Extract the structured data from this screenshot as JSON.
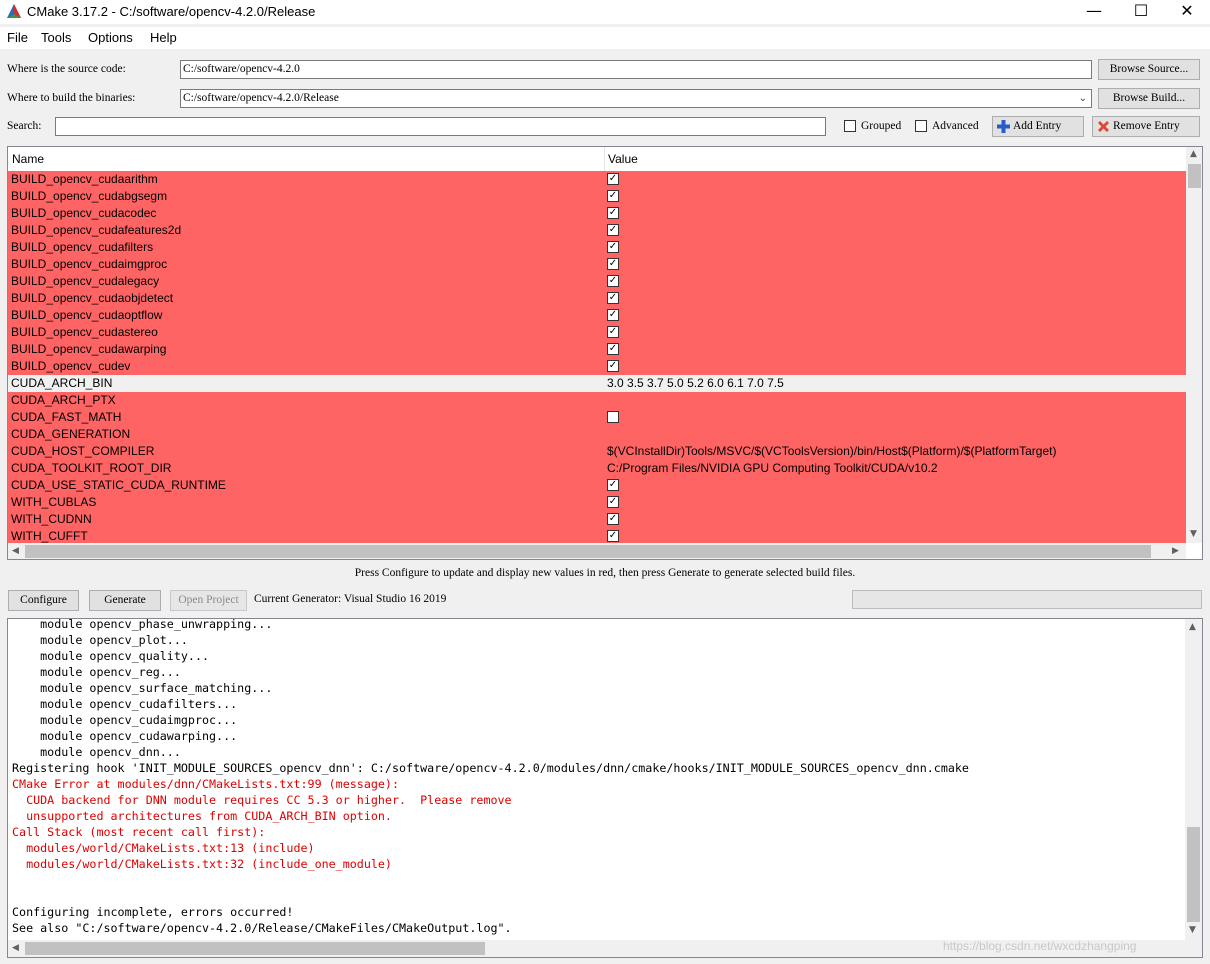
{
  "window": {
    "title": "CMake 3.17.2 - C:/software/opencv-4.2.0/Release",
    "min": "—",
    "max": "☐",
    "close": "✕"
  },
  "menu": [
    "File",
    "Tools",
    "Options",
    "Help"
  ],
  "source": {
    "label": "Where is the source code:",
    "value": "C:/software/opencv-4.2.0",
    "browse": "Browse Source..."
  },
  "build": {
    "label": "Where to build the binaries:",
    "value": "C:/software/opencv-4.2.0/Release",
    "browse": "Browse Build..."
  },
  "search": {
    "label": "Search:",
    "value": ""
  },
  "options": {
    "grouped": "Grouped",
    "advanced": "Advanced",
    "add": "Add Entry",
    "remove": "Remove Entry"
  },
  "table": {
    "columns": [
      "Name",
      "Value"
    ],
    "rows": [
      {
        "name": "BUILD_opencv_cudaarithm",
        "check": true,
        "red": true
      },
      {
        "name": "BUILD_opencv_cudabgsegm",
        "check": true,
        "red": true
      },
      {
        "name": "BUILD_opencv_cudacodec",
        "check": true,
        "red": true
      },
      {
        "name": "BUILD_opencv_cudafeatures2d",
        "check": true,
        "red": true
      },
      {
        "name": "BUILD_opencv_cudafilters",
        "check": true,
        "red": true
      },
      {
        "name": "BUILD_opencv_cudaimgproc",
        "check": true,
        "red": true
      },
      {
        "name": "BUILD_opencv_cudalegacy",
        "check": true,
        "red": true
      },
      {
        "name": "BUILD_opencv_cudaobjdetect",
        "check": true,
        "red": true
      },
      {
        "name": "BUILD_opencv_cudaoptflow",
        "check": true,
        "red": true
      },
      {
        "name": "BUILD_opencv_cudastereo",
        "check": true,
        "red": true
      },
      {
        "name": "BUILD_opencv_cudawarping",
        "check": true,
        "red": true
      },
      {
        "name": "BUILD_opencv_cudev",
        "check": true,
        "red": true
      },
      {
        "name": "CUDA_ARCH_BIN",
        "value": "3.0 3.5 3.7 5.0 5.2 6.0 6.1 7.0 7.5",
        "red": false
      },
      {
        "name": "CUDA_ARCH_PTX",
        "value": "",
        "red": true
      },
      {
        "name": "CUDA_FAST_MATH",
        "check": false,
        "red": true
      },
      {
        "name": "CUDA_GENERATION",
        "value": "",
        "red": true
      },
      {
        "name": "CUDA_HOST_COMPILER",
        "value": "$(VCInstallDir)Tools/MSVC/$(VCToolsVersion)/bin/Host$(Platform)/$(PlatformTarget)",
        "red": true
      },
      {
        "name": "CUDA_TOOLKIT_ROOT_DIR",
        "value": "C:/Program Files/NVIDIA GPU Computing Toolkit/CUDA/v10.2",
        "red": true
      },
      {
        "name": "CUDA_USE_STATIC_CUDA_RUNTIME",
        "check": true,
        "red": true
      },
      {
        "name": "WITH_CUBLAS",
        "check": true,
        "red": true
      },
      {
        "name": "WITH_CUDNN",
        "check": true,
        "red": true
      },
      {
        "name": "WITH_CUFFT",
        "check": true,
        "red": true
      }
    ]
  },
  "hint": "Press Configure to update and display new values in red, then press Generate to generate selected build files.",
  "actions": {
    "configure": "Configure",
    "generate": "Generate",
    "open_project": "Open Project",
    "generator": "Current Generator: Visual Studio 16 2019"
  },
  "log": [
    {
      "text": "    module opencv_phase_unwrapping...",
      "red": false
    },
    {
      "text": "    module opencv_plot...",
      "red": false
    },
    {
      "text": "    module opencv_quality...",
      "red": false
    },
    {
      "text": "    module opencv_reg...",
      "red": false
    },
    {
      "text": "    module opencv_surface_matching...",
      "red": false
    },
    {
      "text": "    module opencv_cudafilters...",
      "red": false
    },
    {
      "text": "    module opencv_cudaimgproc...",
      "red": false
    },
    {
      "text": "    module opencv_cudawarping...",
      "red": false
    },
    {
      "text": "    module opencv_dnn...",
      "red": false
    },
    {
      "text": "Registering hook 'INIT_MODULE_SOURCES_opencv_dnn': C:/software/opencv-4.2.0/modules/dnn/cmake/hooks/INIT_MODULE_SOURCES_opencv_dnn.cmake",
      "red": false
    },
    {
      "text": "CMake Error at modules/dnn/CMakeLists.txt:99 (message):",
      "red": true
    },
    {
      "text": "  CUDA backend for DNN module requires CC 5.3 or higher.  Please remove",
      "red": true
    },
    {
      "text": "  unsupported architectures from CUDA_ARCH_BIN option.",
      "red": true
    },
    {
      "text": "Call Stack (most recent call first):",
      "red": true
    },
    {
      "text": "  modules/world/CMakeLists.txt:13 (include)",
      "red": true
    },
    {
      "text": "  modules/world/CMakeLists.txt:32 (include_one_module)",
      "red": true
    },
    {
      "text": "",
      "red": false
    },
    {
      "text": "",
      "red": false
    },
    {
      "text": "Configuring incomplete, errors occurred!",
      "red": false
    },
    {
      "text": "See also \"C:/software/opencv-4.2.0/Release/CMakeFiles/CMakeOutput.log\".",
      "red": false
    }
  ],
  "watermark": "https://blog.csdn.net/wxcdzhangping",
  "colors": {
    "changed_row": "#ff6464",
    "error_text": "#e00000"
  }
}
